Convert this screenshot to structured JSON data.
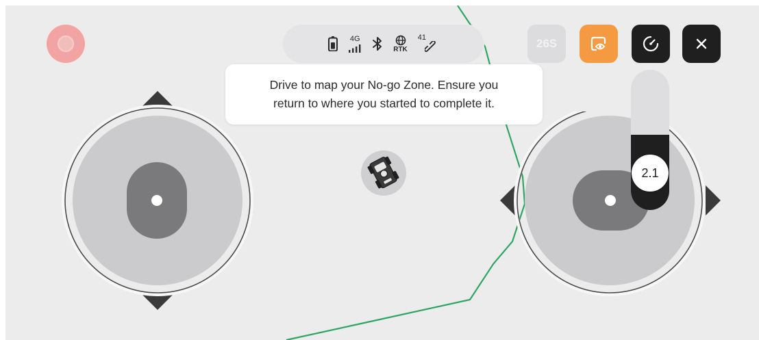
{
  "top_left": {
    "record_icon": "record-icon"
  },
  "status_bar": {
    "battery_icon": "battery-icon",
    "network_label": "4G",
    "signal_icon": "signal-bars-icon",
    "bluetooth_icon": "bluetooth-icon",
    "rtk_icon": "globe-icon",
    "rtk_label": "RTK",
    "satellite_count": "41",
    "satellite_icon": "satellite-link-icon"
  },
  "toolbar": {
    "timer_label": "26S",
    "view_icon": "map-view-icon",
    "speed_icon": "speedometer-icon",
    "close_icon": "close-icon"
  },
  "tooltip": {
    "line1": "Drive to map your No-go Zone. Ensure you",
    "line2": "return to where you started to complete it."
  },
  "mower": {
    "icon": "mower-icon"
  },
  "speed_control": {
    "value": "2.1",
    "level": 0.55
  },
  "colors": {
    "accent_orange": "#f39a42",
    "record_red": "#f2a3a3",
    "path_green": "#2ea563",
    "button_dark": "#1f1f1f",
    "map_background": "#ececed"
  }
}
